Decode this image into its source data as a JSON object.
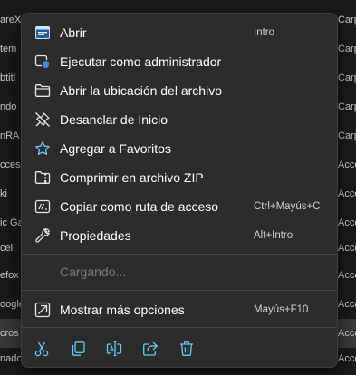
{
  "background": {
    "rows": [
      {
        "name": "areX",
        "type": "Carp"
      },
      {
        "name": "tem",
        "type": "Carp"
      },
      {
        "name": "btitl",
        "type": "Carp"
      },
      {
        "name": "ndo",
        "type": "Carp"
      },
      {
        "name": "nRA",
        "type": "Carp"
      },
      {
        "name": "ccess",
        "type": "Acce"
      },
      {
        "name": "ki",
        "type": "Acce"
      },
      {
        "name": "ic Ga",
        "type": "Acce"
      },
      {
        "name": "cel",
        "type": "Acce"
      },
      {
        "name": "efox",
        "type": "Acce"
      },
      {
        "name": "oogle",
        "type": "Acce"
      },
      {
        "name": "cros",
        "type": "Acce"
      },
      {
        "name": "nado",
        "type": "Acce"
      }
    ]
  },
  "menu": {
    "items": [
      {
        "label": "Abrir",
        "shortcut": "Intro",
        "icon": "open-app-icon"
      },
      {
        "label": "Ejecutar como administrador",
        "shortcut": "",
        "icon": "shield-icon"
      },
      {
        "label": "Abrir la ubicación del archivo",
        "shortcut": "",
        "icon": "folder-icon"
      },
      {
        "label": "Desanclar de Inicio",
        "shortcut": "",
        "icon": "unpin-icon"
      },
      {
        "label": "Agregar a Favoritos",
        "shortcut": "",
        "icon": "star-icon"
      },
      {
        "label": "Comprimir en archivo ZIP",
        "shortcut": "",
        "icon": "zip-folder-icon"
      },
      {
        "label": "Copiar como ruta de acceso",
        "shortcut": "Ctrl+Mayús+C",
        "icon": "copy-path-icon"
      },
      {
        "label": "Propiedades",
        "shortcut": "Alt+Intro",
        "icon": "wrench-icon"
      }
    ],
    "loading_label": "Cargando...",
    "more_options": {
      "label": "Mostrar más opciones",
      "shortcut": "Mayús+F10",
      "icon": "more-options-icon"
    },
    "toolbar": [
      {
        "name": "cut",
        "icon": "scissors-icon"
      },
      {
        "name": "copy",
        "icon": "copy-icon"
      },
      {
        "name": "rename",
        "icon": "rename-icon"
      },
      {
        "name": "share",
        "icon": "share-icon"
      },
      {
        "name": "delete",
        "icon": "trash-icon"
      }
    ],
    "accent_color": "#60cdff"
  }
}
